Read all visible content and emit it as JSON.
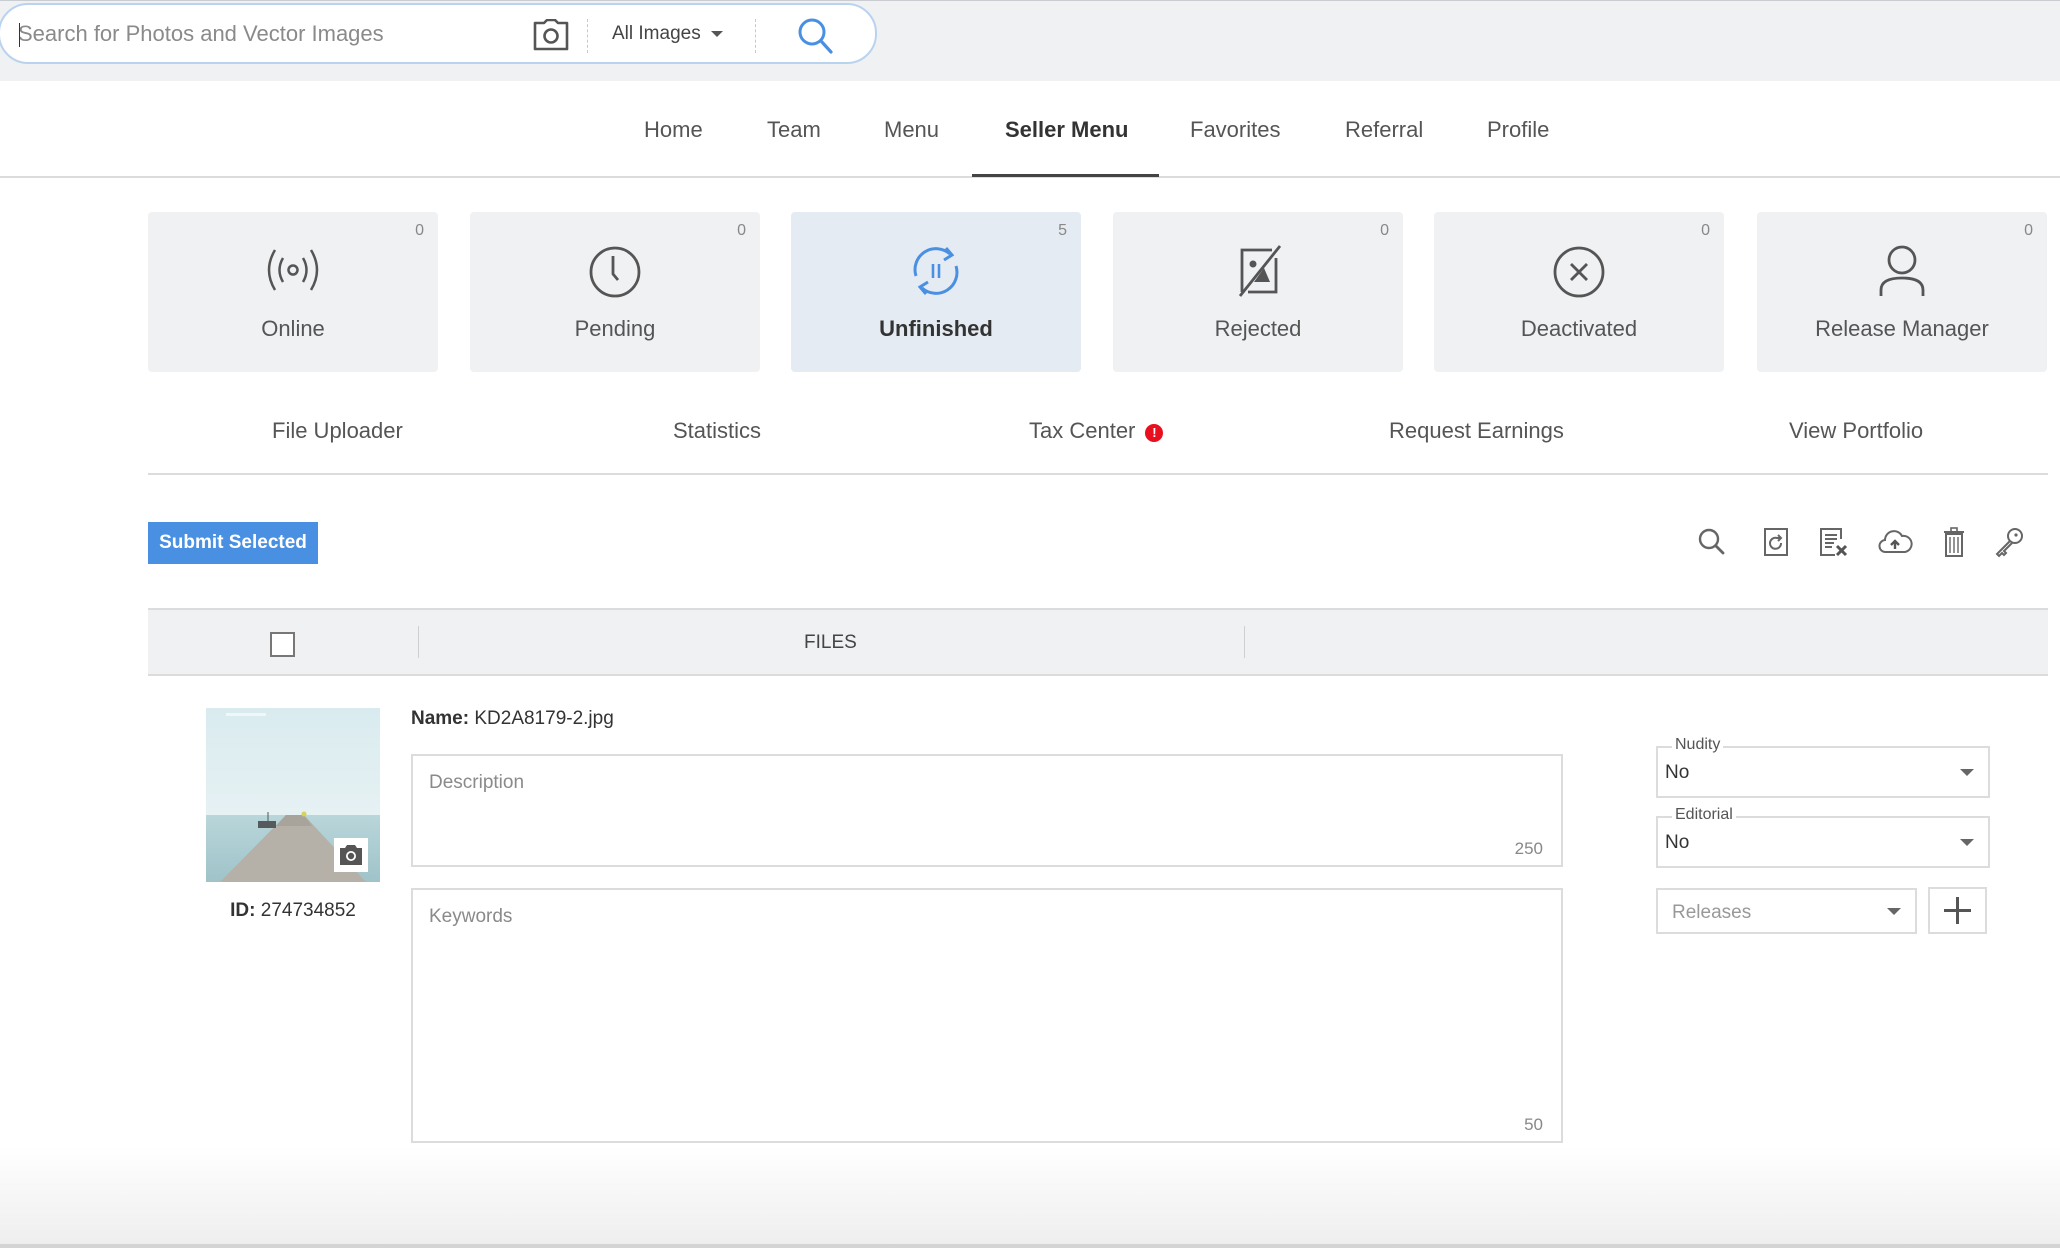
{
  "search": {
    "placeholder": "Search for Photos and Vector Images",
    "value": "",
    "scope_selected": "All Images",
    "camera_icon": "camera-icon",
    "search_icon": "search-icon"
  },
  "nav": {
    "tabs": [
      {
        "label": "Home",
        "active": false
      },
      {
        "label": "Team",
        "active": false
      },
      {
        "label": "Menu",
        "active": false
      },
      {
        "label": "Seller Menu",
        "active": true
      },
      {
        "label": "Favorites",
        "active": false
      },
      {
        "label": "Referral",
        "active": false
      },
      {
        "label": "Profile",
        "active": false
      }
    ]
  },
  "status_cards": [
    {
      "label": "Online",
      "count": "0",
      "icon": "broadcast-icon",
      "active": false
    },
    {
      "label": "Pending",
      "count": "0",
      "icon": "clock-icon",
      "active": false
    },
    {
      "label": "Unfinished",
      "count": "5",
      "icon": "sync-pause-icon",
      "active": true
    },
    {
      "label": "Rejected",
      "count": "0",
      "icon": "image-rejected-icon",
      "active": false
    },
    {
      "label": "Deactivated",
      "count": "0",
      "icon": "x-circle-icon",
      "active": false
    },
    {
      "label": "Release Manager",
      "count": "0",
      "icon": "user-icon",
      "active": false
    }
  ],
  "sub_links": [
    {
      "label": "File Uploader"
    },
    {
      "label": "Statistics"
    },
    {
      "label": "Tax Center",
      "alert": "!"
    },
    {
      "label": "Request Earnings"
    },
    {
      "label": "View Portfolio"
    }
  ],
  "toolbar": {
    "submit_label": "Submit Selected",
    "tools": [
      "search-icon",
      "reload-file-icon",
      "clear-text-icon",
      "cloud-upload-icon",
      "trash-icon",
      "key-icon"
    ]
  },
  "table": {
    "header_files": "FILES",
    "row": {
      "name_label": "Name:",
      "name_value": "KD2A8179-2.jpg",
      "id_label": "ID:",
      "id_value": "274734852",
      "description_placeholder": "Description",
      "description_value": "",
      "description_remaining": "250",
      "keywords_placeholder": "Keywords",
      "keywords_value": "",
      "keywords_remaining": "50",
      "nudity_label": "Nudity",
      "nudity_value": "No",
      "editorial_label": "Editorial",
      "editorial_value": "No",
      "releases_placeholder": "Releases",
      "add_release_label": "+"
    }
  },
  "colors": {
    "accent": "#4a90e2",
    "alert": "#e8101e",
    "active_card": "#e5ebf3",
    "card": "#f0f1f3"
  }
}
